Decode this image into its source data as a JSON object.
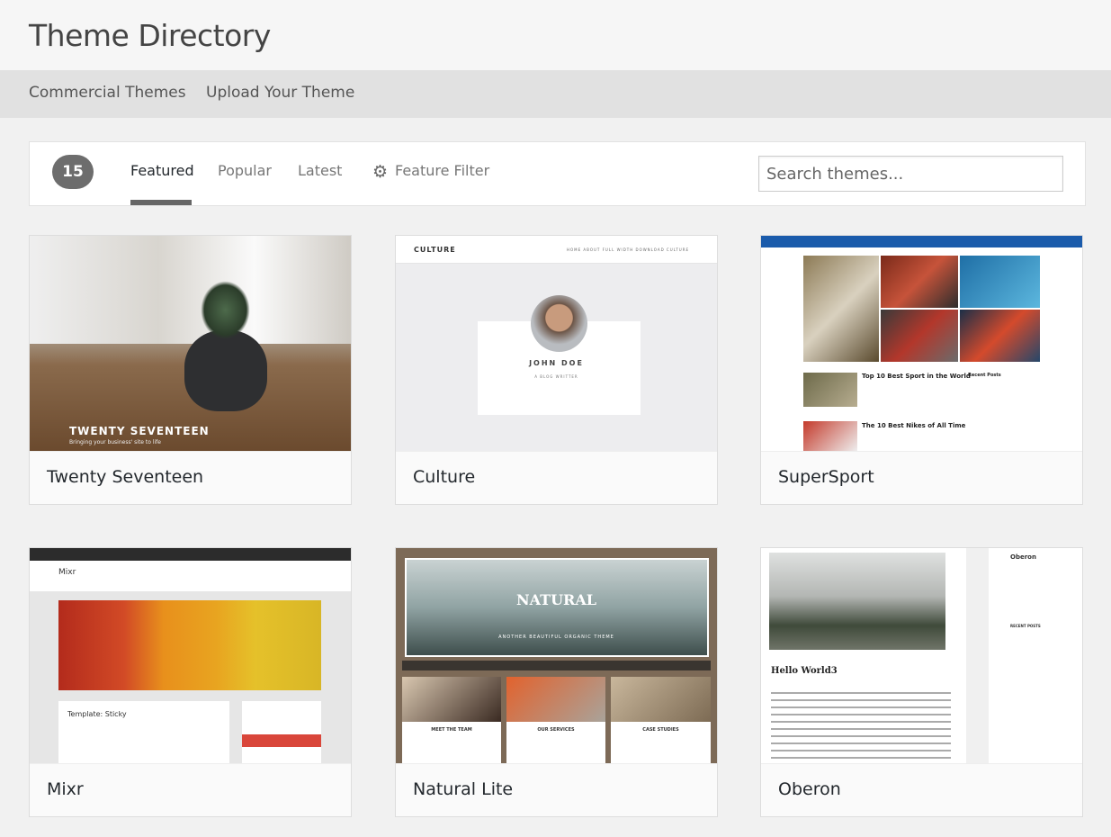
{
  "header": {
    "title": "Theme Directory"
  },
  "nav": {
    "items": [
      "Commercial Themes",
      "Upload Your Theme"
    ]
  },
  "filter": {
    "count": "15",
    "tabs": [
      "Featured",
      "Popular",
      "Latest"
    ],
    "active_tab": "Featured",
    "feature_filter": "Feature Filter",
    "feature_filter_icon": "gear-icon",
    "search_placeholder": "Search themes..."
  },
  "themes": [
    {
      "name": "Twenty Seventeen",
      "preview": {
        "title": "TWENTY SEVENTEEN",
        "tagline": "Bringing your business' site to life"
      }
    },
    {
      "name": "Culture",
      "preview": {
        "logo": "CULTURE",
        "menu": "HOME  ABOUT  FULL WIDTH  DOWNLOAD CULTURE",
        "person": "JOHN DOE",
        "role": "A BLOG WRITTER"
      }
    },
    {
      "name": "SuperSport",
      "preview": {
        "headline": "Top 10 Best Sport in the World",
        "headline2": "The 10 Best Nikes of All Time",
        "sidebar": "Recent Posts"
      }
    },
    {
      "name": "Mixr",
      "preview": {
        "logo": "Mixr",
        "post": "Template: Sticky"
      }
    },
    {
      "name": "Natural Lite",
      "preview": {
        "logo": "NATURAL",
        "tagline": "ANOTHER BEAUTIFUL ORGANIC THEME",
        "cols": [
          "MEET THE TEAM",
          "OUR SERVICES",
          "CASE STUDIES"
        ]
      }
    },
    {
      "name": "Oberon",
      "preview": {
        "post": "Hello World3",
        "site": "Oberon",
        "sidebar": "RECENT POSTS"
      }
    }
  ]
}
